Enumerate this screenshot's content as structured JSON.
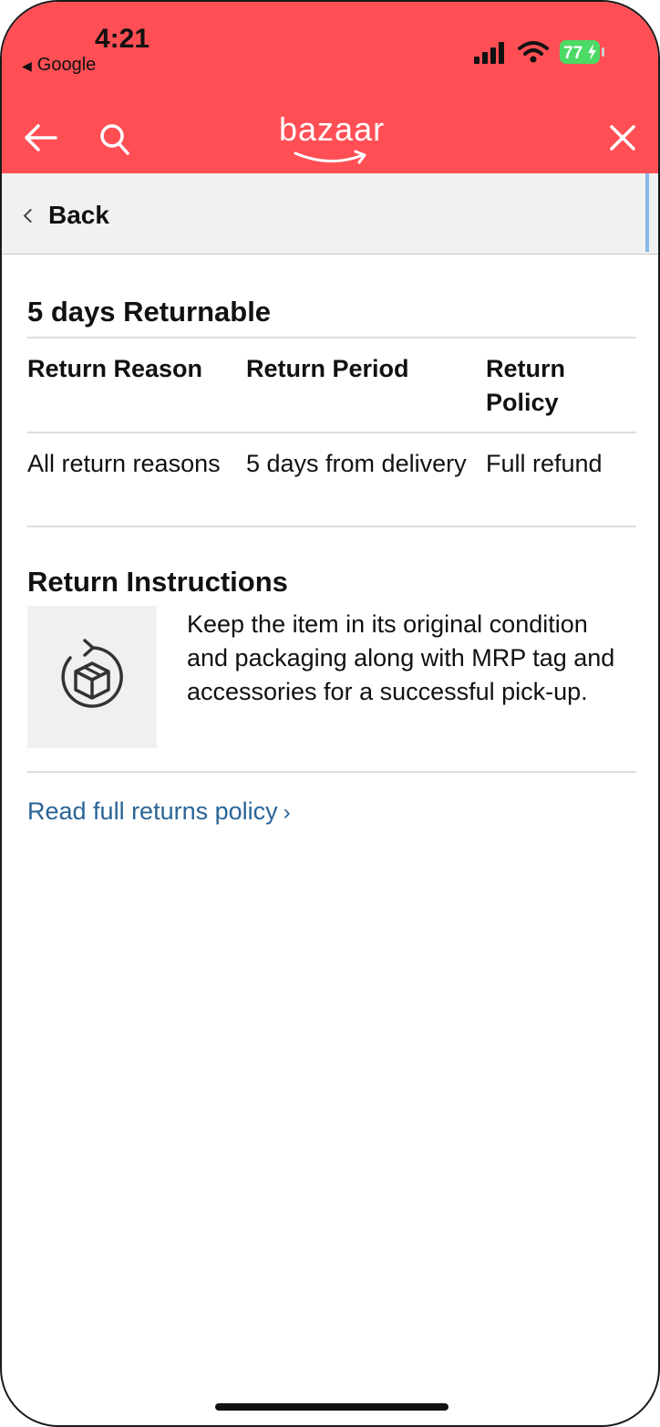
{
  "status_bar": {
    "time": "4:21",
    "back_app": "Google",
    "battery": "77"
  },
  "nav": {
    "logo_text": "bazaar",
    "back_icon": "arrow-left-icon",
    "search_icon": "search-icon",
    "close_icon": "close-icon"
  },
  "back_bar": {
    "label": "Back"
  },
  "returns": {
    "title": "5 days Returnable",
    "headers": [
      "Return Reason",
      "Return Period",
      "Return Policy"
    ],
    "rows": [
      [
        "All return reasons",
        "5 days from delivery",
        "Full refund"
      ]
    ],
    "instructions_title": "Return Instructions",
    "instructions_text": "Keep the item in its original condition and packaging along with MRP tag and accessories for a successful pick-up.",
    "link_text": "Read full returns policy"
  },
  "colors": {
    "header": "#ff4f55",
    "link": "#2a6496",
    "battery": "#4cd964"
  }
}
